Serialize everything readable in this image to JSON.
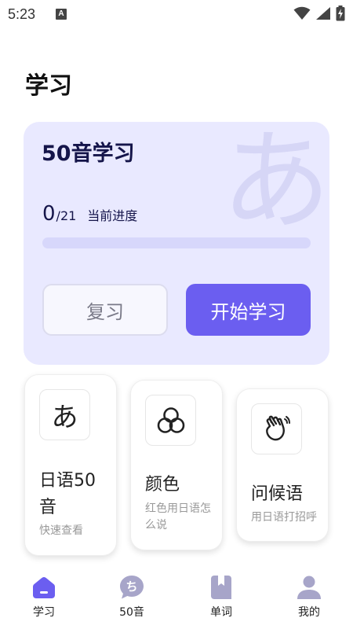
{
  "status_bar": {
    "time": "5:23",
    "indicator": "A"
  },
  "page": {
    "title": "学习"
  },
  "hero": {
    "title": "50音学习",
    "watermark": "あ",
    "progress_current": "0",
    "progress_total": "/21",
    "progress_label": "当前进度",
    "progress_fraction": 0,
    "review_label": "复习",
    "start_label": "开始学习"
  },
  "features": [
    {
      "icon": "hiragana-a-icon",
      "glyph": "あ",
      "title": "日语50音",
      "subtitle": "快速查看"
    },
    {
      "icon": "color-circles-icon",
      "title": "颜色",
      "subtitle": "红色用日语怎么说"
    },
    {
      "icon": "waving-hand-icon",
      "title": "问候语",
      "subtitle": "用日语打招呼"
    }
  ],
  "nav": {
    "items": [
      {
        "label": "学习",
        "icon": "home-icon",
        "active": true
      },
      {
        "label": "50音",
        "icon": "kana-chi-icon",
        "glyph": "ち"
      },
      {
        "label": "单词",
        "icon": "bookmark-book-icon"
      },
      {
        "label": "我的",
        "icon": "person-icon"
      }
    ]
  },
  "colors": {
    "accent": "#6b5ef0",
    "hero_bg": "#e9e9ff",
    "nav_icon": "#a7a5c9"
  }
}
